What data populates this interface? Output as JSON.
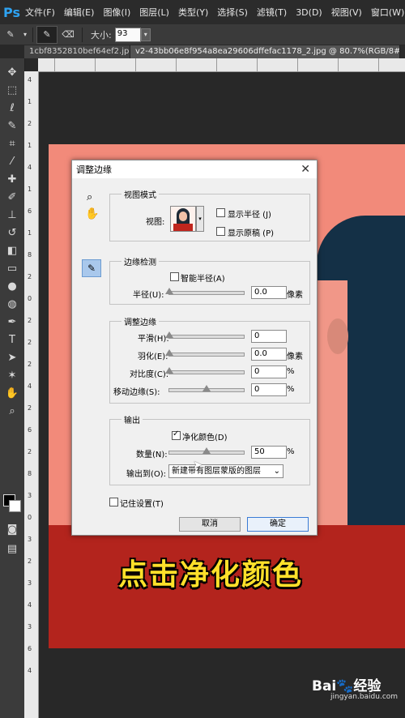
{
  "menubar": {
    "logo": "Ps",
    "items": [
      "文件(F)",
      "编辑(E)",
      "图像(I)",
      "图层(L)",
      "类型(Y)",
      "选择(S)",
      "滤镜(T)",
      "3D(D)",
      "视图(V)",
      "窗口(W)"
    ]
  },
  "options": {
    "size_label": "大小:",
    "size_value": "93"
  },
  "tabs": [
    {
      "label": "1cbf8352810bef64ef2.jpg"
    },
    {
      "label": "v2-43bb06e8f954a8ea29606dffefac1178_2.jpg @ 80.7%(RGB/8#)"
    }
  ],
  "ruler_left": [
    "4",
    "1",
    "2",
    "1",
    "4",
    "1",
    "6",
    "1",
    "8",
    "2",
    "0",
    "2",
    "2",
    "2",
    "4",
    "2",
    "6",
    "2",
    "8",
    "3",
    "0",
    "3",
    "2",
    "3",
    "4",
    "3",
    "6",
    "4"
  ],
  "dialog": {
    "title": "调整边缘",
    "view_mode": {
      "title": "视图模式",
      "view_label": "视图:",
      "show_radius": "显示半径 (J)",
      "show_original": "显示原稿 (P)"
    },
    "edge_detection": {
      "title": "边缘检测",
      "smart_radius": "智能半径(A)",
      "radius_label": "半径(U):",
      "radius_value": "0.0",
      "radius_unit": "像素"
    },
    "adjust_edge": {
      "title": "调整边缘",
      "smooth_label": "平滑(H):",
      "smooth_value": "0",
      "feather_label": "羽化(E):",
      "feather_value": "0.0",
      "feather_unit": "像素",
      "contrast_label": "对比度(C):",
      "contrast_value": "0",
      "contrast_unit": "%",
      "shift_label": "移动边缘(S):",
      "shift_value": "0",
      "shift_unit": "%"
    },
    "output": {
      "title": "输出",
      "decontaminate": "净化颜色(D)",
      "amount_label": "数量(N):",
      "amount_value": "50",
      "amount_unit": "%",
      "amount_level": 0.5,
      "output_to_label": "输出到(O):",
      "output_to_value": "新建带有图层蒙版的图层"
    },
    "remember": "记住设置(T)",
    "cancel": "取消",
    "ok": "确定"
  },
  "subtitle": "点击净化颜色",
  "watermark": {
    "brand": "Bai🐾经验",
    "url": "jingyan.baidu.com"
  },
  "colors": {
    "canvas_bg": "#f28a7a",
    "shirt": "#b3241d",
    "hair": "#143046",
    "subtitle": "#ffe02a",
    "ps_blue": "#2ea3f2"
  }
}
